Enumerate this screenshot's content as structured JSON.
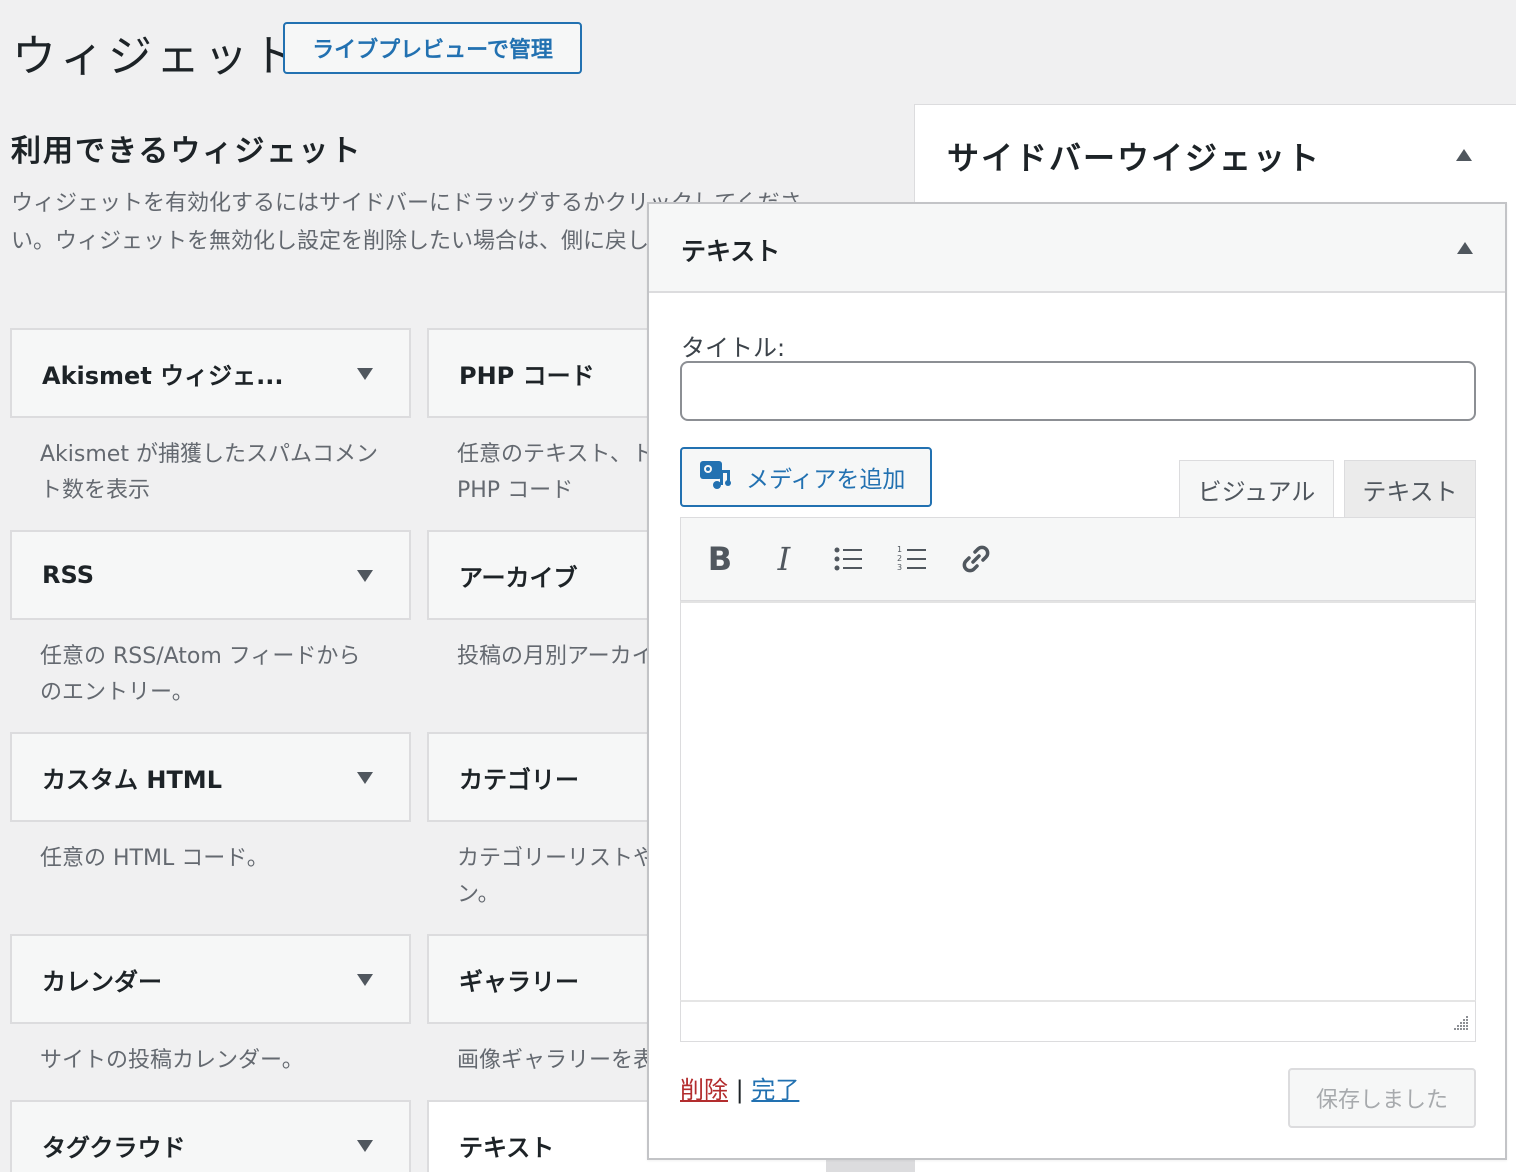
{
  "header": {
    "title": "ウィジェット",
    "live_preview_button": "ライブプレビューで管理"
  },
  "available": {
    "title": "利用できるウィジェット",
    "description": "ウィジェットを有効化するにはサイドバーにドラッグするかクリックしてください。ウィジェットを無効化し設定を削除したい場合は、側に戻してください。",
    "widgets": [
      {
        "title": "Akismet ウィジェ...",
        "desc": "Akismet が捕獲したスパムコメント数を表示"
      },
      {
        "title": "PHP コード",
        "desc": "任意のテキスト、ト PHP コード"
      },
      {
        "title": "RSS",
        "desc": "任意の RSS/Atom フィードからのエントリー。"
      },
      {
        "title": "アーカイブ",
        "desc": "投稿の月別アーカイ"
      },
      {
        "title": "カスタム HTML",
        "desc": "任意の HTML コード。"
      },
      {
        "title": "カテゴリー",
        "desc": "カテゴリーリストや ン。"
      },
      {
        "title": "カレンダー",
        "desc": "サイトの投稿カレンダー。"
      },
      {
        "title": "ギャラリー",
        "desc": "画像ギャラリーを表"
      },
      {
        "title": "タグクラウド",
        "desc": ""
      },
      {
        "title": "テキスト",
        "desc": ""
      }
    ]
  },
  "sidebar": {
    "title": "サイドバーウイジェット"
  },
  "text_widget": {
    "title": "テキスト",
    "title_label": "タイトル:",
    "title_value": "",
    "add_media": "メディアを追加",
    "tab_visual": "ビジュアル",
    "tab_text": "テキスト",
    "toolbar": {
      "bold": "B",
      "italic": "I"
    },
    "delete": "削除",
    "separator": "|",
    "done": "完了",
    "saved": "保存しました"
  },
  "icons": [
    "widget-collapse-arrow",
    "bullet-list-icon",
    "numbered-list-icon",
    "link-icon",
    "media-icon",
    "resize-handle-icon"
  ],
  "colors": {
    "accent": "#2271b1",
    "delete": "#b32d2e",
    "background": "#f0f0f1"
  }
}
